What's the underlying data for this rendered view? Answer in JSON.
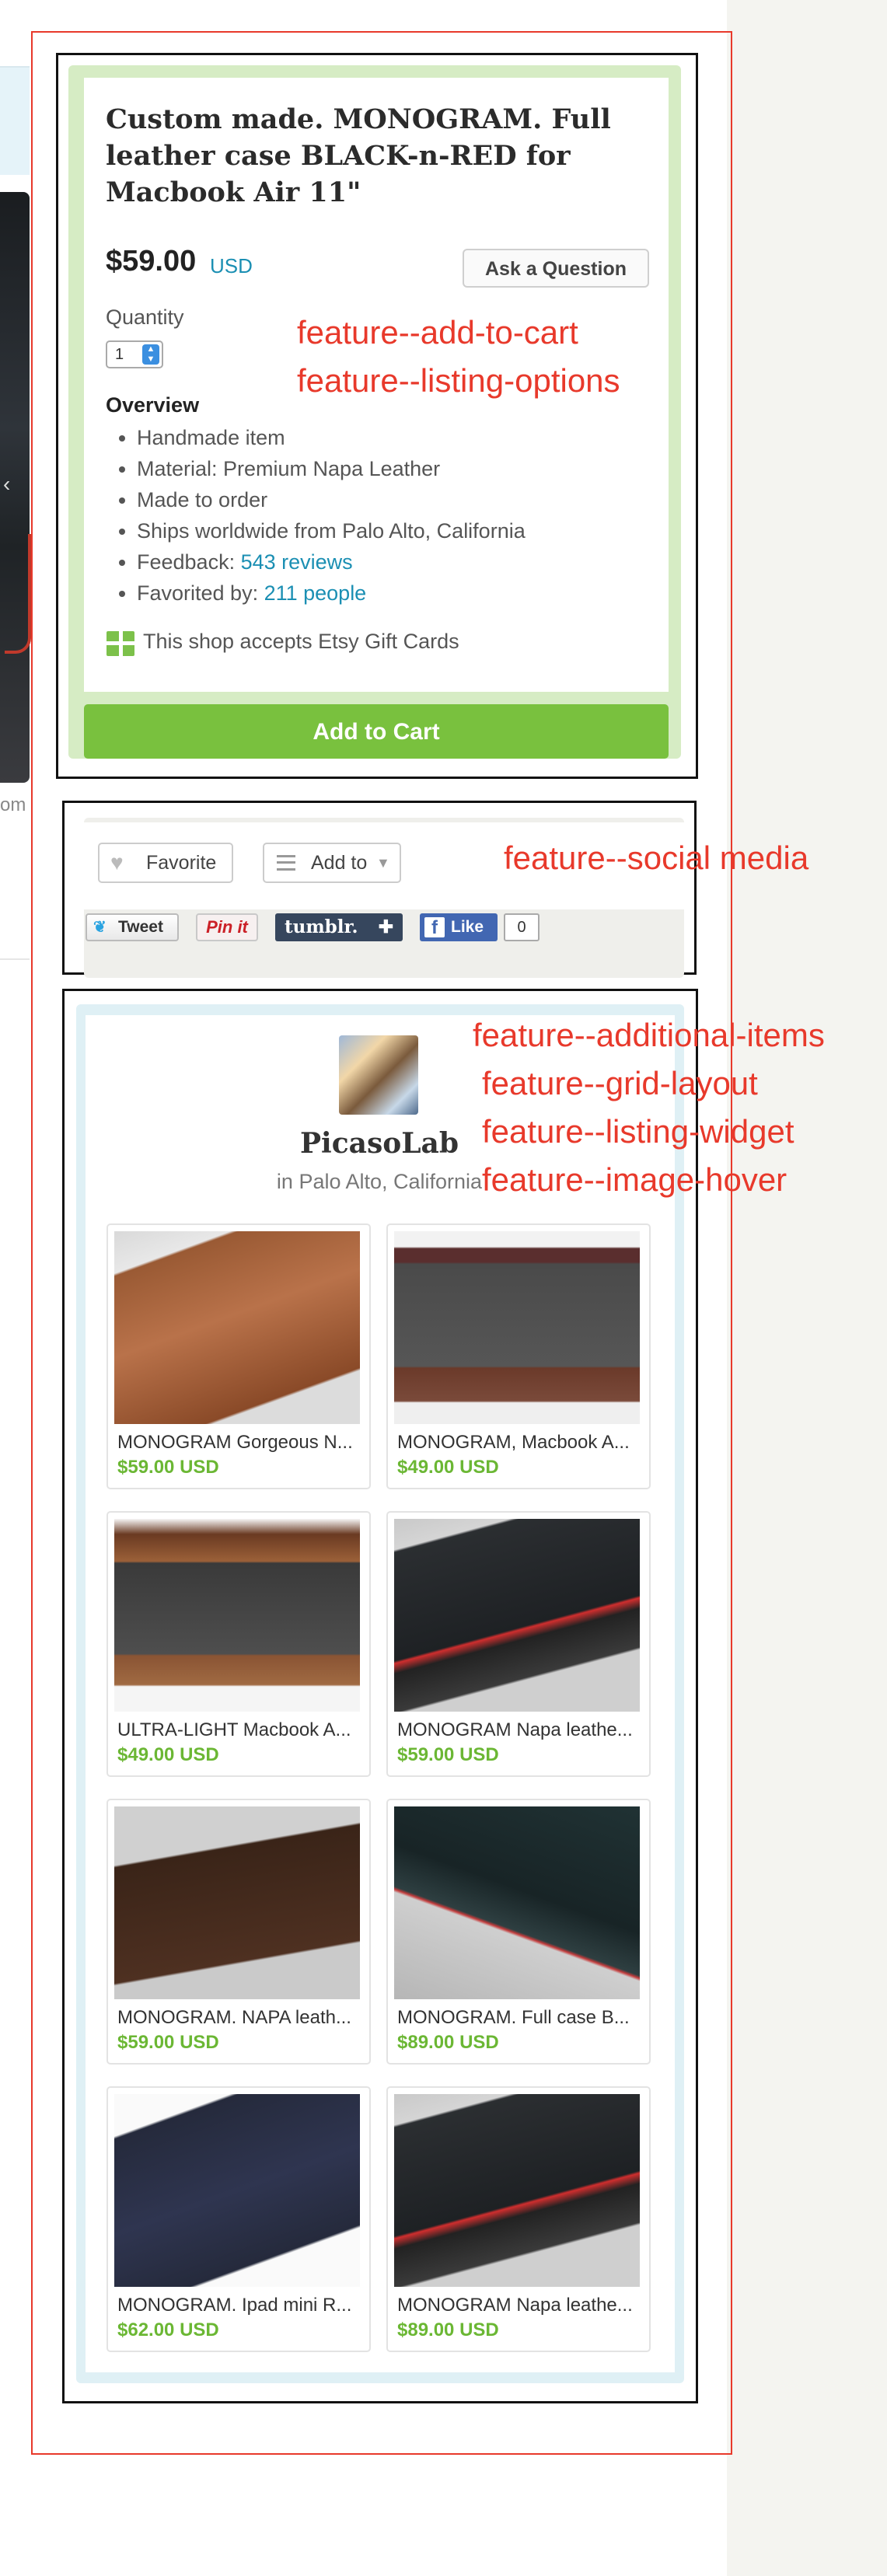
{
  "listing": {
    "title": "Custom made. MONOGRAM. Full leather case BLACK-n-RED for Macbook Air 11\"",
    "price": "$59.00",
    "currency": "USD",
    "ask_button": "Ask a Question",
    "quantity_label": "Quantity",
    "quantity_value": "1",
    "overview_heading": "Overview",
    "overview": {
      "item1": "Handmade item",
      "item2": "Material: Premium Napa Leather",
      "item3": "Made to order",
      "item4": "Ships worldwide from Palo Alto, California",
      "feedback_label": "Feedback: ",
      "feedback_link": "543 reviews",
      "favorited_label": "Favorited by: ",
      "favorited_link": "211 people"
    },
    "gift_cards_text": "This shop accepts Etsy Gift Cards",
    "add_to_cart": "Add to Cart"
  },
  "social": {
    "favorite": "Favorite",
    "add_to": "Add to",
    "tweet": "Tweet",
    "pinit": "Pin it",
    "tumblr": "tumblr.",
    "tumblr_plus": "✚",
    "like": "Like",
    "like_count": "0"
  },
  "shop": {
    "name": "PicasoLab",
    "location": "in Palo Alto, California",
    "items": [
      {
        "name": "MONOGRAM Gorgeous N...",
        "price": "$59.00 USD"
      },
      {
        "name": "MONOGRAM, Macbook A...",
        "price": "$49.00 USD"
      },
      {
        "name": "ULTRA-LIGHT Macbook A...",
        "price": "$49.00 USD"
      },
      {
        "name": "MONOGRAM Napa leathe...",
        "price": "$59.00 USD"
      },
      {
        "name": "MONOGRAM. NAPA leath...",
        "price": "$59.00 USD"
      },
      {
        "name": "MONOGRAM. Full case B...",
        "price": "$89.00 USD"
      },
      {
        "name": "MONOGRAM. Ipad mini R...",
        "price": "$62.00 USD"
      },
      {
        "name": "MONOGRAM Napa leathe...",
        "price": "$89.00 USD"
      }
    ]
  },
  "left_partial": {
    "text": "om"
  },
  "annotations": {
    "a1": "feature--add-to-cart",
    "a2": "feature--listing-options",
    "a3": "feature--social media",
    "a4": "feature--additional-items",
    "a5": "feature--grid-layout",
    "a6": "feature--listing-widget",
    "a7": "feature--image-hover"
  },
  "colors": {
    "annotation": "#e8392b",
    "add_to_cart": "#79c13e",
    "link": "#1b8fb3",
    "price_green": "#6bb734"
  }
}
